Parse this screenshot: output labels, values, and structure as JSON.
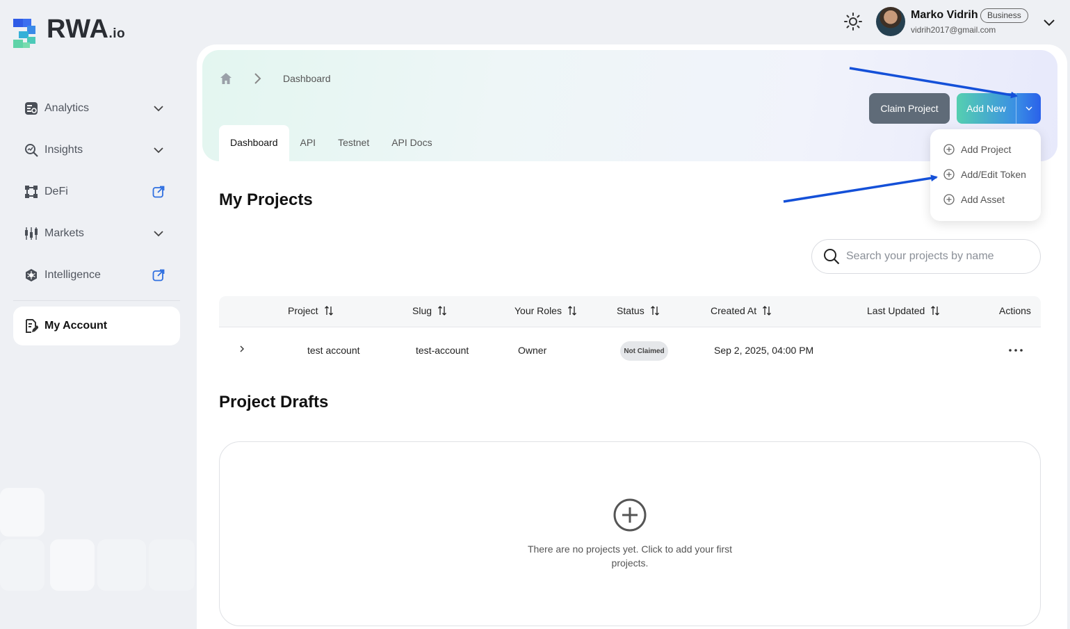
{
  "brand": {
    "name": "RWA",
    "suffix": ".io"
  },
  "sidebar": {
    "items": [
      {
        "label": "Analytics",
        "icon": "analytics-icon",
        "trail": "chevron-down"
      },
      {
        "label": "Insights",
        "icon": "insights-icon",
        "trail": "chevron-down"
      },
      {
        "label": "DeFi",
        "icon": "defi-icon",
        "trail": "external-link"
      },
      {
        "label": "Markets",
        "icon": "markets-icon",
        "trail": "chevron-down"
      },
      {
        "label": "Intelligence",
        "icon": "intelligence-icon",
        "trail": "external-link"
      }
    ],
    "active_item": {
      "label": "My Account",
      "icon": "account-icon"
    }
  },
  "user": {
    "name": "Marko Vidrih",
    "badge": "Business",
    "email": "vidrih2017@gmail.com"
  },
  "breadcrumb": {
    "current": "Dashboard"
  },
  "tabs": [
    {
      "label": "Dashboard",
      "active": true
    },
    {
      "label": "API",
      "active": false
    },
    {
      "label": "Testnet",
      "active": false
    },
    {
      "label": "API Docs",
      "active": false
    }
  ],
  "actions": {
    "claim_label": "Claim Project",
    "add_new_label": "Add New"
  },
  "add_menu": {
    "items": [
      {
        "label": "Add Project"
      },
      {
        "label": "Add/Edit Token"
      },
      {
        "label": "Add Asset"
      }
    ]
  },
  "projects": {
    "heading": "My Projects",
    "search_placeholder": "Search your projects by name",
    "columns": [
      "Project",
      "Slug",
      "Your Roles",
      "Status",
      "Created At",
      "Last Updated",
      "Actions"
    ],
    "rows": [
      {
        "project": "test account",
        "slug": "test-account",
        "roles": "Owner",
        "status": "Not Claimed",
        "created_at": "Sep 2, 2025, 04:00 PM",
        "last_updated": ""
      }
    ]
  },
  "drafts": {
    "heading": "Project Drafts",
    "empty_text": "There are no projects yet. Click to add your first projects."
  },
  "colors": {
    "accent_gradient_start": "#55cfb0",
    "accent_gradient_end": "#2a61ea",
    "claim_button": "#5f6b78",
    "annotation_arrow": "#1450d8"
  }
}
